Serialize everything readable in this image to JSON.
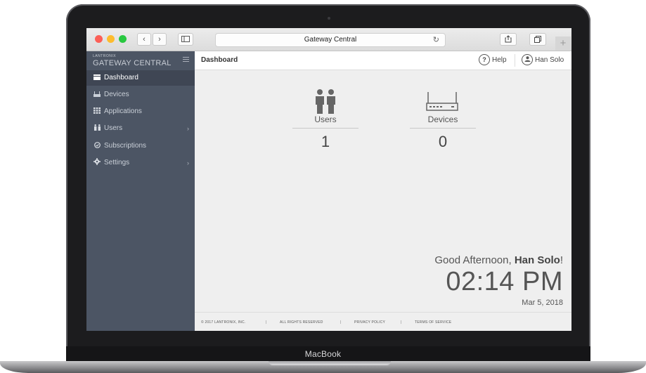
{
  "device": {
    "brand_label": "MacBook"
  },
  "browser": {
    "address_title": "Gateway Central",
    "back_icon": "chevron-left-icon",
    "forward_icon": "chevron-right-icon",
    "new_tab_label": "+"
  },
  "sidebar": {
    "logo_small": "LANTRONIX",
    "logo_big": "GATEWAY CENTRAL",
    "items": [
      {
        "label": "Dashboard",
        "icon": "dashboard-icon",
        "active": true
      },
      {
        "label": "Devices",
        "icon": "devices-icon",
        "active": false
      },
      {
        "label": "Applications",
        "icon": "grid-icon",
        "active": false
      },
      {
        "label": "Users",
        "icon": "users-icon",
        "active": false,
        "has_children": true
      },
      {
        "label": "Subscriptions",
        "icon": "check-circle-icon",
        "active": false
      },
      {
        "label": "Settings",
        "icon": "gear-icon",
        "active": false,
        "has_children": true
      }
    ]
  },
  "header": {
    "breadcrumb": "Dashboard",
    "help_label": "Help",
    "help_glyph": "?",
    "user_name": "Han Solo"
  },
  "stats": {
    "users": {
      "label": "Users",
      "value": "1"
    },
    "devices": {
      "label": "Devices",
      "value": "0"
    }
  },
  "greeting": {
    "prefix": "Good Afternoon, ",
    "name": "Han Solo",
    "suffix": "!",
    "time": "02:14 PM",
    "date": "Mar 5, 2018"
  },
  "footer": {
    "copyright": "© 2017 LANTRONIX, INC.",
    "rights": "ALL RIGHTS RESERVED",
    "privacy": "PRIVACY POLICY",
    "terms": "TERMS OF SERVICE",
    "separator": "|"
  },
  "colors": {
    "sidebar_bg": "#4c5564",
    "sidebar_active": "#3f4654",
    "content_bg": "#efefef",
    "traffic_red": "#fc5f57",
    "traffic_yellow": "#fdbc2e",
    "traffic_green": "#28c840"
  }
}
